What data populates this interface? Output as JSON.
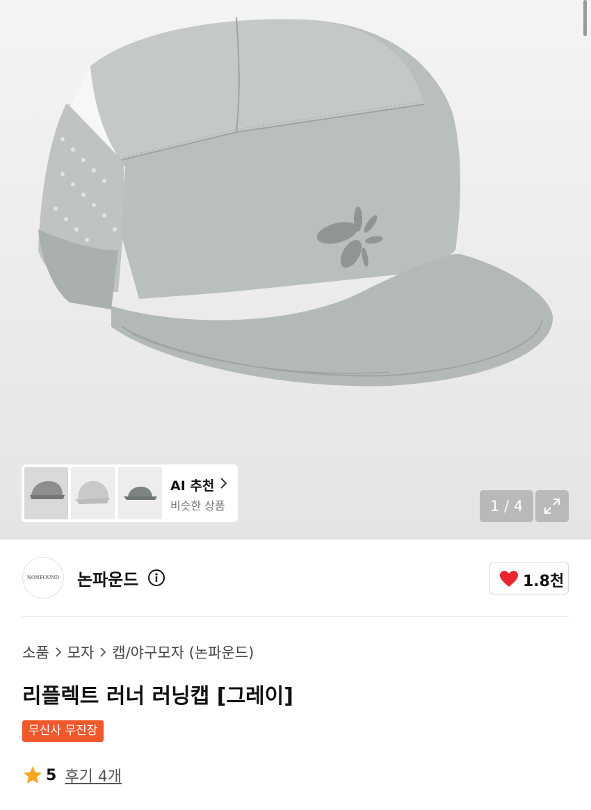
{
  "product_gallery": {
    "pager_text": "1 / 4",
    "ai_recommend": {
      "title": "AI 추천",
      "subtitle": "비슷한 상품"
    }
  },
  "brand": {
    "logo_text": "NONFOUND",
    "name": "논파운드",
    "likes": "1.8천"
  },
  "breadcrumb": [
    "소품",
    "모자",
    "캡/야구모자 (논파운드)"
  ],
  "product": {
    "title": "리플렉트 러너 러닝캡 [그레이]",
    "badge": "무신사 무진장",
    "rating": "5",
    "reviews": "후기 4개"
  },
  "colors": {
    "accent_orange": "#f0582a",
    "heart_red": "#e8262d",
    "star_orange": "#f5a623"
  },
  "icons": [
    "chevron-right-icon",
    "expand-icon",
    "info-icon",
    "heart-icon",
    "star-icon"
  ]
}
